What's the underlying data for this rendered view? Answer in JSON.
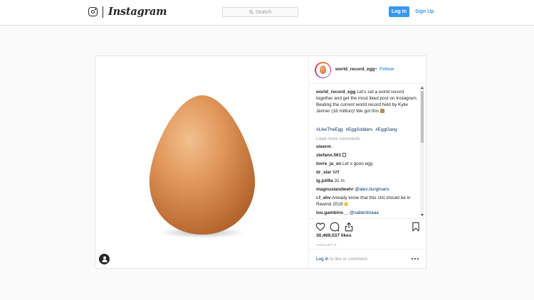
{
  "header": {
    "wordmark": "Instagram",
    "search_placeholder": "Search",
    "login_label": "Log In",
    "signup_label": "Sign Up"
  },
  "post": {
    "username": "world_record_egg",
    "separator": "•",
    "follow_label": "Follow",
    "caption": {
      "username": "world_record_egg",
      "text": "Let's set a world record together and get the most liked post on Instagram. Beating the current world record held by Kylie Jenner (18 million)! We got this"
    },
    "hashtags": [
      "#LikeTheEgg",
      "#EggSoldiers",
      "#EggGang"
    ],
    "load_more_label": "Load more comments",
    "comments": [
      {
        "user": "oieerm",
        "text": "."
      },
      {
        "user": "stefano.561",
        "text": ""
      },
      {
        "user": "lovre_ja_sn",
        "text": "Let s gooo egg"
      },
      {
        "user": "dr_slar",
        "text": "Wtf"
      },
      {
        "user": "ig.juli9a",
        "text": "31 m"
      },
      {
        "user": "magnuslandwehr",
        "mention": "@alex.burgmans"
      },
      {
        "user": "r.f_ehv",
        "text": "Already know that this shit should be in Rewind 2019"
      },
      {
        "user": "lou.gambino__",
        "mention": "@sabbriiinaaa"
      }
    ],
    "likes": "30,469,037 likes",
    "date": "JANUARY 4",
    "login_prompt": {
      "link": "Log in",
      "text": " to like or comment."
    }
  },
  "icons": [
    "instagram-glyph-icon",
    "search-icon",
    "user-tag-icon",
    "heart-icon",
    "comment-icon",
    "share-icon",
    "bookmark-icon",
    "more-options-icon"
  ],
  "colors": {
    "accent": "#3897f0",
    "link": "#003569",
    "muted": "#999999",
    "text": "#262626",
    "egg": "#d8894a"
  }
}
